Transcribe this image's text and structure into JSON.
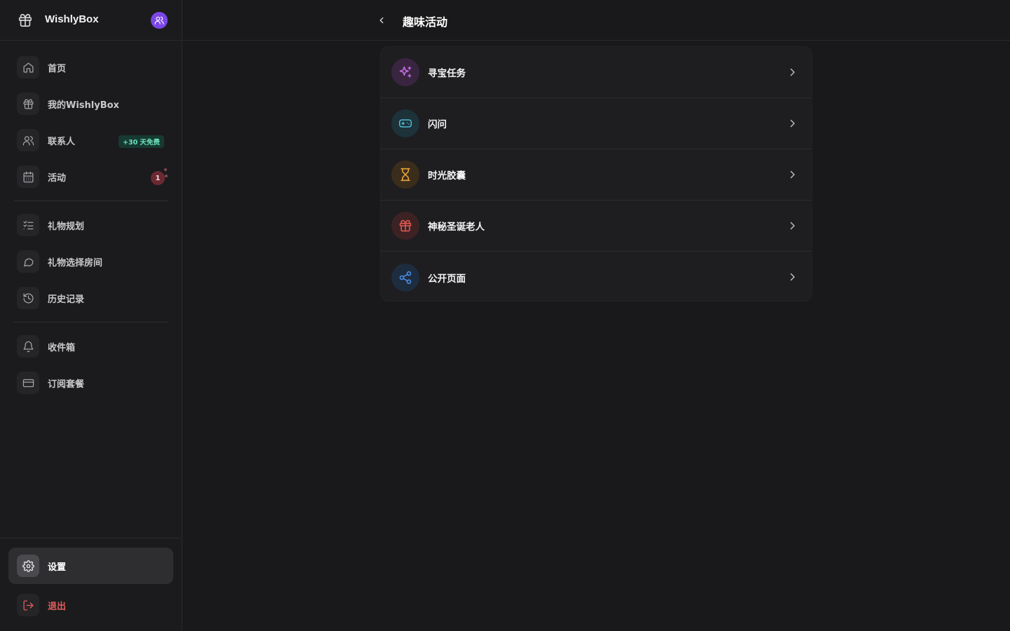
{
  "brand": {
    "name": "WishlyBox",
    "logo_icon": "gift-icon",
    "avatar_icon": "users-icon",
    "avatar_color": "#7b46e8"
  },
  "sidebar": {
    "items": [
      {
        "label": "首页",
        "icon": "home-icon"
      },
      {
        "label": "我的WishlyBox",
        "icon": "gift-icon"
      },
      {
        "label": "联系人",
        "icon": "users-icon",
        "badge": "+30 天免费"
      },
      {
        "label": "活动",
        "icon": "calendar-icon",
        "badge_count": "1"
      },
      {
        "label": "礼物规划",
        "icon": "list-checks-icon"
      },
      {
        "label": "礼物选择房间",
        "icon": "chat-bubble-icon"
      },
      {
        "label": "历史记录",
        "icon": "history-icon"
      },
      {
        "label": "收件箱",
        "icon": "bell-icon"
      },
      {
        "label": "订阅套餐",
        "icon": "credit-card-icon"
      }
    ],
    "settings_label": "设置",
    "logout_label": "退出"
  },
  "header": {
    "title": "趣味活动",
    "back_icon": "chevron-left-icon"
  },
  "activities": [
    {
      "label": "寻宝任务",
      "icon": "sparkles-icon",
      "color": "#c26be0",
      "bg": "#3a2541"
    },
    {
      "label": "闪问",
      "icon": "gamepad-icon",
      "color": "#4fb7cf",
      "bg": "#1d3239"
    },
    {
      "label": "时光胶囊",
      "icon": "hourglass-icon",
      "color": "#e6a43a",
      "bg": "#3b2d1c"
    },
    {
      "label": "神秘圣诞老人",
      "icon": "gift-icon",
      "color": "#e4574f",
      "bg": "#3d2224"
    },
    {
      "label": "公开页面",
      "icon": "share-icon",
      "color": "#4a8ee6",
      "bg": "#1e2c3f"
    }
  ],
  "colors": {
    "accent_free": "#6fe0bb",
    "danger": "#e35d5d"
  }
}
